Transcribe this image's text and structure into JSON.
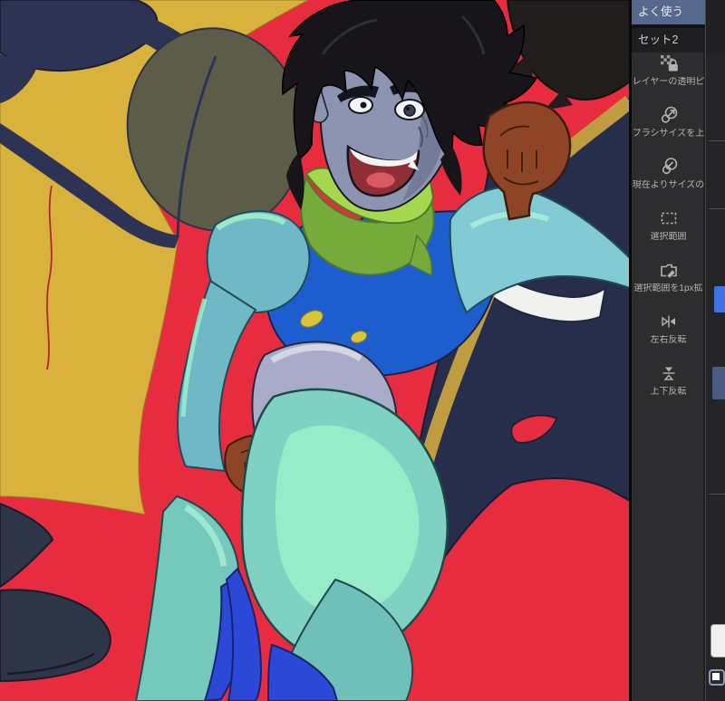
{
  "quick_access": {
    "tabs": [
      {
        "label": "よく使う",
        "selected": true
      },
      {
        "label": "セット2",
        "selected": false
      }
    ],
    "items": [
      {
        "label": "レイヤーの透明ピ",
        "icon": "transparent-pixels-lock-icon"
      },
      {
        "label": "ブラシサイズを上",
        "icon": "brush-size-up-icon"
      },
      {
        "label": "現在よりサイズの",
        "icon": "brush-size-down-icon"
      },
      {
        "label": "選択範囲",
        "icon": "selection-marquee-icon"
      },
      {
        "label": "選択範囲を1px拡",
        "icon": "selection-expand-icon"
      },
      {
        "label": "左右反転",
        "icon": "flip-horizontal-icon"
      },
      {
        "label": "上下反転",
        "icon": "flip-vertical-icon"
      }
    ]
  },
  "side_strip": {
    "markers": [
      {
        "name": "blue-marker",
        "color": "#3e72e0"
      },
      {
        "name": "slate-marker",
        "color": "#4a5a80"
      }
    ],
    "swatches": [
      {
        "name": "paper-color-swatch",
        "color": "#f0f0f0"
      },
      {
        "name": "transparent-color-chip",
        "color": "#ffffff"
      }
    ]
  },
  "canvas": {
    "colors": {
      "background_red": "#e82c40",
      "yellow_figure": "#d8b23c",
      "olive_shape": "#5c5c49",
      "navy_figure": "#272e4b",
      "gold_stripe": "#bf9c40",
      "white_belt": "#f1f1ef",
      "hero_suit_teal": "#7fd2c2",
      "hero_suit_blue": "#1d5ecf",
      "hero_scarf_green": "#a6d84f",
      "hero_skin": "#8d94b2",
      "hero_hair": "#17151a",
      "hero_gloves": "#8e4527",
      "hip_grey": "#a9abc8",
      "boot_blue": "#2b49d6"
    }
  }
}
